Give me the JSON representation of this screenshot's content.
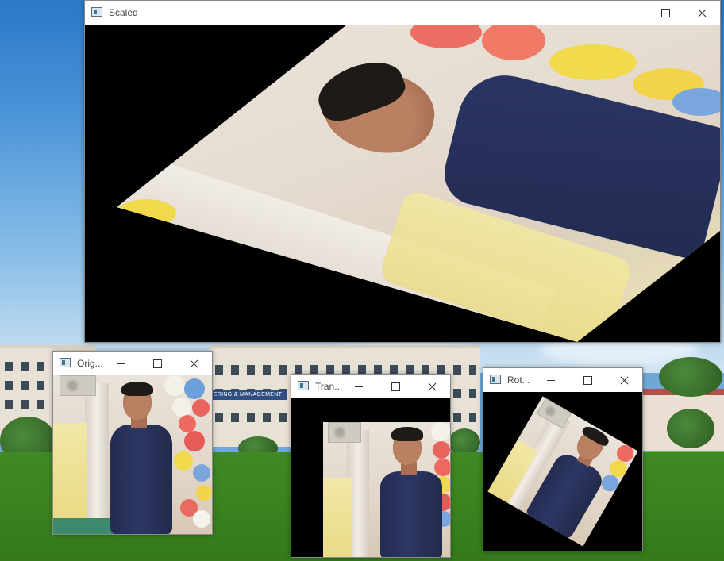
{
  "windows": {
    "scaled": {
      "title": "Scaled"
    },
    "original": {
      "title": "Orig..."
    },
    "translated": {
      "title": "Tran..."
    },
    "rotated": {
      "title": "Rot..."
    }
  },
  "wallpaper": {
    "sign_text": "ERING & MANAGEMENT"
  },
  "colors": {
    "titlebar_bg": "#ffffff",
    "content_bg": "#000000",
    "lawn": "#3a8220",
    "sky": "#4a93d8"
  },
  "icons": [
    "app-window-icon",
    "minimize-icon",
    "maximize-icon",
    "close-icon"
  ]
}
